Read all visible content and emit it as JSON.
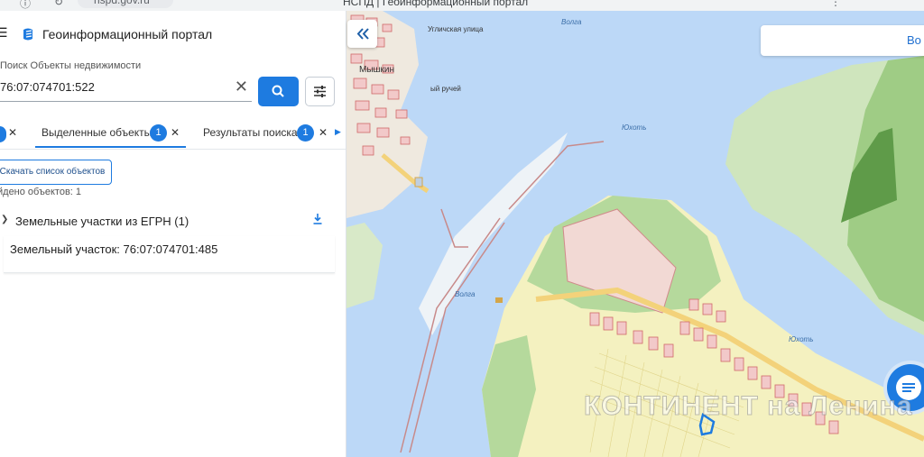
{
  "browser": {
    "url": "nspd.gov.ru",
    "tab_title": "НСПД | Геоинформационный портал"
  },
  "header": {
    "title": "Геоинформационный портал"
  },
  "search": {
    "label": "Поиск Объекты недвижимости",
    "value": "76:07:074701:522"
  },
  "tabs": [
    {
      "label": "Выделенные объекты",
      "count": "1"
    },
    {
      "label": "Результаты поиска",
      "count": "1"
    }
  ],
  "actions": {
    "download_list": "Скачать список объектов"
  },
  "results": {
    "found_text": "йдено объектов: 1",
    "group_title": "Земельные участки из ЕГРН (1)",
    "items": [
      {
        "text": "Земельный участок: 76:07:074701:485"
      }
    ]
  },
  "map": {
    "search_button_text": "Во",
    "labels": {
      "town": "Мышкин",
      "street": "Угличская улица",
      "stream": "ый ручей",
      "river": "Волга",
      "river2": "Юхоть"
    },
    "watermark": "КОНТИНЕНТ на Ленина"
  },
  "colors": {
    "accent": "#1e7be0",
    "water": "#bcd8f7",
    "forest": "#b5d99c",
    "field": "#f4f1c0",
    "parcel_fill": "#f2c9c9",
    "parcel_stroke": "#d06a6a"
  }
}
